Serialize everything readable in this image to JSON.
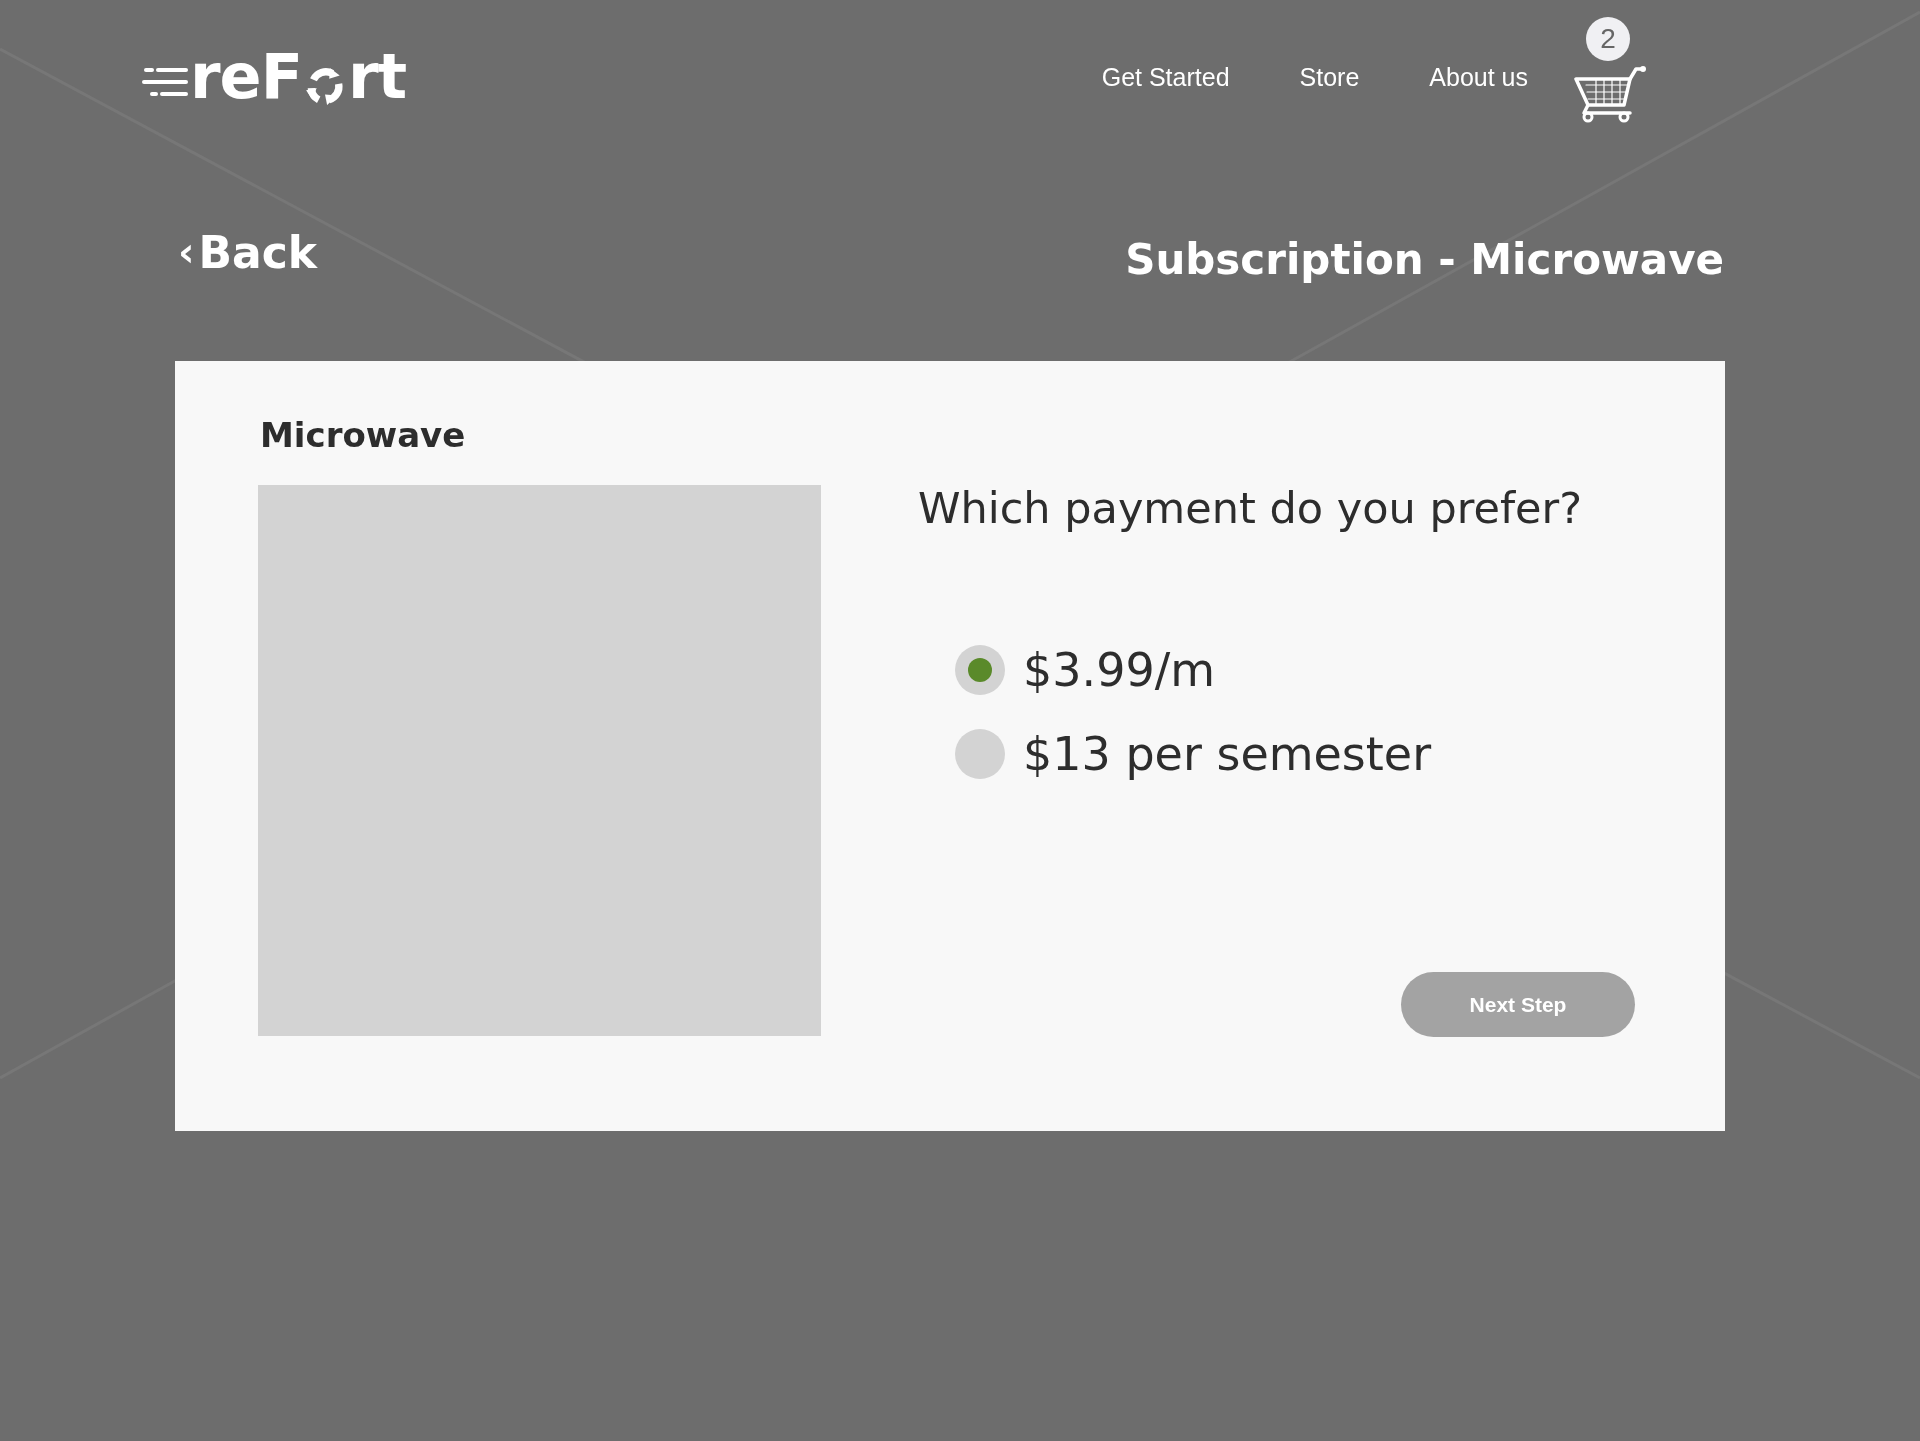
{
  "header": {
    "logo": {
      "text_start": "reF",
      "text_end": "rt"
    },
    "nav": [
      "Get Started",
      "Store",
      "About us"
    ],
    "cart": {
      "count": "2"
    }
  },
  "back_link": {
    "icon": "‹",
    "label": "Back"
  },
  "page_title": "Subscription - Microwave",
  "card": {
    "product_name": "Microwave",
    "product_image": {
      "kind": "placeholder"
    },
    "question": "Which payment do you prefer?",
    "options": [
      {
        "label": "$3.99/m",
        "selected": true
      },
      {
        "label": "$13 per semester",
        "selected": false
      }
    ],
    "next_button": {
      "label": "Next Step",
      "disabled": true
    }
  }
}
